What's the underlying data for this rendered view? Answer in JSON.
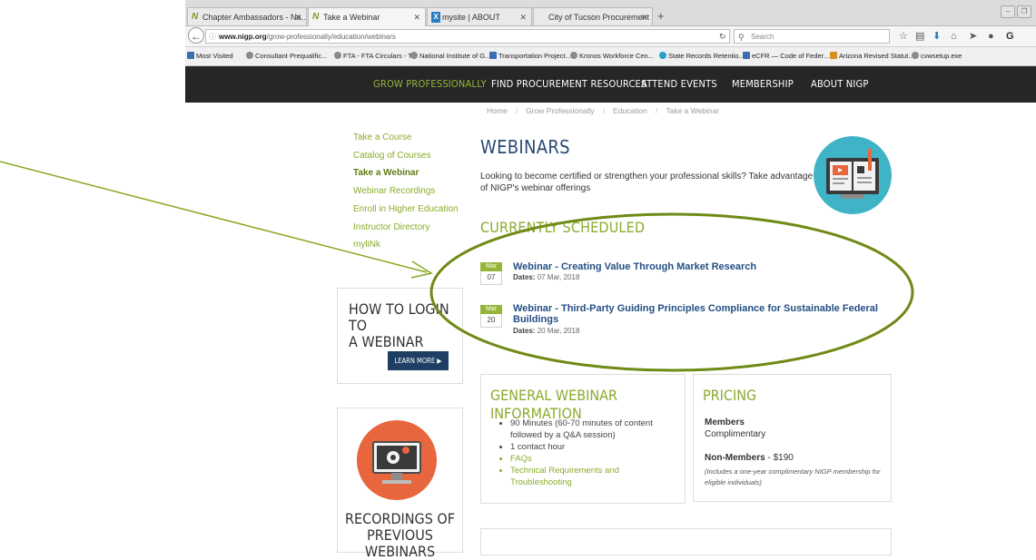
{
  "browser": {
    "tabs": [
      {
        "title": "Chapter Ambassadors - Na...",
        "icon_letter": "N"
      },
      {
        "title": "Take a Webinar",
        "icon_letter": "N"
      },
      {
        "title": "mysite | ABOUT",
        "icon_letter": "X"
      },
      {
        "title": "City of Tucson Procurement Site",
        "icon_letter": ""
      }
    ],
    "url_domain": "www.nigp.org",
    "url_path": "/grow-professionally/education/webinars",
    "search_placeholder": "Search",
    "bookmarks": [
      "Most Visited",
      "Consultant Prequalific...",
      "FTA - FTA Circulars - T...",
      "National Institute of G...",
      "Transportation Project...",
      "Kronos Workforce Cen...",
      "State Records Retentio...",
      "eCFR — Code of Feder...",
      "Arizona Revised Statut...",
      "cvwsetup.exe"
    ]
  },
  "site_nav": [
    "GROW PROFESSIONALLY",
    "FIND PROCUREMENT RESOURCES",
    "ATTEND EVENTS",
    "MEMBERSHIP",
    "ABOUT NIGP"
  ],
  "breadcrumb": [
    "Home",
    "Grow Professionally",
    "Education",
    "Take a Webinar"
  ],
  "sidebar": {
    "links": [
      "Take a Course",
      "Catalog of Courses",
      "Take a Webinar",
      "Webinar Recordings",
      "Enroll in Higher Education",
      "Instructor Directory",
      "myliNk"
    ],
    "login_box": {
      "title_line1": "HOW TO LOGIN TO",
      "title_line2": "A WEBINAR",
      "button": "LEARN MORE"
    },
    "recordings_box": {
      "title_line1": "RECORDINGS OF",
      "title_line2": "PREVIOUS WEBINARS"
    }
  },
  "main": {
    "title": "WEBINARS",
    "intro": "Looking to become certified or strengthen your professional skills? Take advantage of NIGP's webinar offerings",
    "scheduled_heading": "CURRENTLY SCHEDULED",
    "events": [
      {
        "month": "Mar",
        "day": "07",
        "title_line1": "Webinar - Creating Value Through Market Research",
        "title_line2": "",
        "dates_label": "Dates:",
        "dates": "07 Mar, 2018"
      },
      {
        "month": "Mar",
        "day": "20",
        "title_line1": "Webinar - Third-Party Guiding Principles Compliance for Sustainable Federal",
        "title_line2": "Buildings",
        "dates_label": "Dates:",
        "dates": "20 Mar, 2018"
      }
    ],
    "general_info": {
      "title": "GENERAL WEBINAR INFORMATION",
      "items": [
        {
          "text": "90 Minutes (60-70 minutes of content followed by a Q&A session)",
          "link": false
        },
        {
          "text": "1 contact hour",
          "link": false
        },
        {
          "text": "FAQs",
          "link": true
        },
        {
          "text": "Technical Requirements and Troubleshooting",
          "link": true
        }
      ]
    },
    "pricing": {
      "title": "PRICING",
      "members_label": "Members",
      "members_value": "Complimentary",
      "nonmembers_label": "Non-Members",
      "nonmembers_value": "- $190",
      "note": "(Includes a one-year complimentary NIGP membership for eligible individuals)"
    }
  },
  "colors": {
    "accent_green": "#8aab2c",
    "heading_blue": "#284a75",
    "nav_bg": "#262626",
    "annotation": "#7d9a1a"
  }
}
